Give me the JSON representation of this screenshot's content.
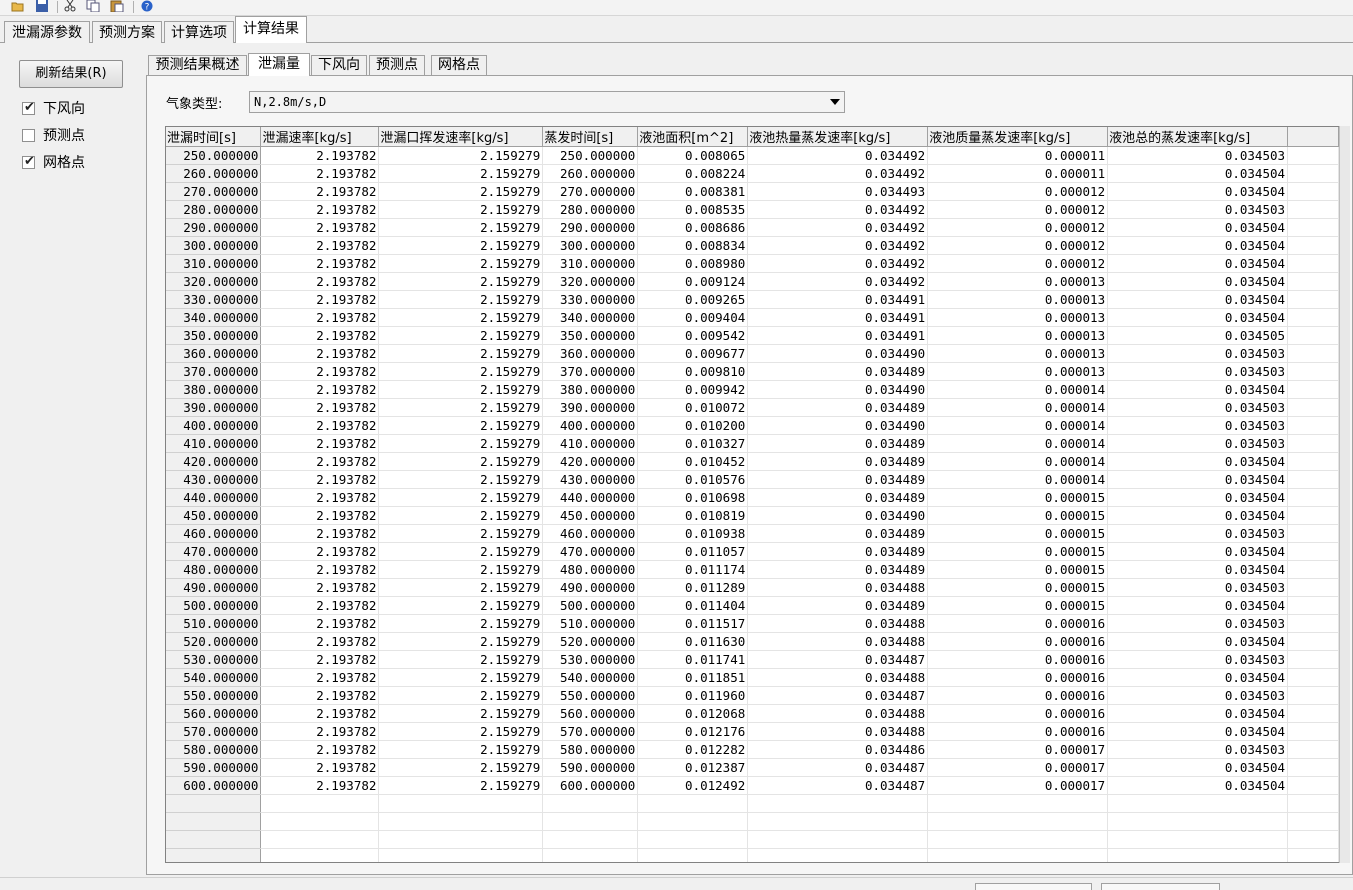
{
  "toolbar": {
    "icons": [
      "open-folder-icon",
      "save-icon",
      "cut-icon",
      "copy-icon",
      "paste-icon",
      "help-icon"
    ]
  },
  "main_tabs": [
    {
      "label": "泄漏源参数",
      "active": false
    },
    {
      "label": "预测方案",
      "active": false
    },
    {
      "label": "计算选项",
      "active": false
    },
    {
      "label": "计算结果",
      "active": true
    }
  ],
  "left_panel": {
    "refresh_label": "刷新结果(R)",
    "checkboxes": [
      {
        "label": "下风向",
        "checked": true
      },
      {
        "label": "预测点",
        "checked": false
      },
      {
        "label": "网格点",
        "checked": true
      }
    ]
  },
  "sub_tabs": [
    {
      "label": "预测结果概述",
      "active": false
    },
    {
      "label": "泄漏量",
      "active": true
    },
    {
      "label": "下风向",
      "active": false
    },
    {
      "label": "预测点",
      "active": false
    },
    {
      "label": "网格点",
      "active": false
    }
  ],
  "weather": {
    "label": "气象类型:",
    "value": "N,2.8m/s,D"
  },
  "table": {
    "columns": [
      "泄漏时间[s]",
      "泄漏速率[kg/s]",
      "泄漏口挥发速率[kg/s]",
      "蒸发时间[s]",
      "液池面积[m^2]",
      "液池热量蒸发速率[kg/s]",
      "液池质量蒸发速率[kg/s]",
      "液池总的蒸发速率[kg/s]"
    ],
    "rows": [
      [
        "250.000000",
        "2.193782",
        "2.159279",
        "250.000000",
        "0.008065",
        "0.034492",
        "0.000011",
        "0.034503"
      ],
      [
        "260.000000",
        "2.193782",
        "2.159279",
        "260.000000",
        "0.008224",
        "0.034492",
        "0.000011",
        "0.034504"
      ],
      [
        "270.000000",
        "2.193782",
        "2.159279",
        "270.000000",
        "0.008381",
        "0.034493",
        "0.000012",
        "0.034504"
      ],
      [
        "280.000000",
        "2.193782",
        "2.159279",
        "280.000000",
        "0.008535",
        "0.034492",
        "0.000012",
        "0.034503"
      ],
      [
        "290.000000",
        "2.193782",
        "2.159279",
        "290.000000",
        "0.008686",
        "0.034492",
        "0.000012",
        "0.034504"
      ],
      [
        "300.000000",
        "2.193782",
        "2.159279",
        "300.000000",
        "0.008834",
        "0.034492",
        "0.000012",
        "0.034504"
      ],
      [
        "310.000000",
        "2.193782",
        "2.159279",
        "310.000000",
        "0.008980",
        "0.034492",
        "0.000012",
        "0.034504"
      ],
      [
        "320.000000",
        "2.193782",
        "2.159279",
        "320.000000",
        "0.009124",
        "0.034492",
        "0.000013",
        "0.034504"
      ],
      [
        "330.000000",
        "2.193782",
        "2.159279",
        "330.000000",
        "0.009265",
        "0.034491",
        "0.000013",
        "0.034504"
      ],
      [
        "340.000000",
        "2.193782",
        "2.159279",
        "340.000000",
        "0.009404",
        "0.034491",
        "0.000013",
        "0.034504"
      ],
      [
        "350.000000",
        "2.193782",
        "2.159279",
        "350.000000",
        "0.009542",
        "0.034491",
        "0.000013",
        "0.034505"
      ],
      [
        "360.000000",
        "2.193782",
        "2.159279",
        "360.000000",
        "0.009677",
        "0.034490",
        "0.000013",
        "0.034503"
      ],
      [
        "370.000000",
        "2.193782",
        "2.159279",
        "370.000000",
        "0.009810",
        "0.034489",
        "0.000013",
        "0.034503"
      ],
      [
        "380.000000",
        "2.193782",
        "2.159279",
        "380.000000",
        "0.009942",
        "0.034490",
        "0.000014",
        "0.034504"
      ],
      [
        "390.000000",
        "2.193782",
        "2.159279",
        "390.000000",
        "0.010072",
        "0.034489",
        "0.000014",
        "0.034503"
      ],
      [
        "400.000000",
        "2.193782",
        "2.159279",
        "400.000000",
        "0.010200",
        "0.034490",
        "0.000014",
        "0.034503"
      ],
      [
        "410.000000",
        "2.193782",
        "2.159279",
        "410.000000",
        "0.010327",
        "0.034489",
        "0.000014",
        "0.034503"
      ],
      [
        "420.000000",
        "2.193782",
        "2.159279",
        "420.000000",
        "0.010452",
        "0.034489",
        "0.000014",
        "0.034504"
      ],
      [
        "430.000000",
        "2.193782",
        "2.159279",
        "430.000000",
        "0.010576",
        "0.034489",
        "0.000014",
        "0.034504"
      ],
      [
        "440.000000",
        "2.193782",
        "2.159279",
        "440.000000",
        "0.010698",
        "0.034489",
        "0.000015",
        "0.034504"
      ],
      [
        "450.000000",
        "2.193782",
        "2.159279",
        "450.000000",
        "0.010819",
        "0.034490",
        "0.000015",
        "0.034504"
      ],
      [
        "460.000000",
        "2.193782",
        "2.159279",
        "460.000000",
        "0.010938",
        "0.034489",
        "0.000015",
        "0.034503"
      ],
      [
        "470.000000",
        "2.193782",
        "2.159279",
        "470.000000",
        "0.011057",
        "0.034489",
        "0.000015",
        "0.034504"
      ],
      [
        "480.000000",
        "2.193782",
        "2.159279",
        "480.000000",
        "0.011174",
        "0.034489",
        "0.000015",
        "0.034504"
      ],
      [
        "490.000000",
        "2.193782",
        "2.159279",
        "490.000000",
        "0.011289",
        "0.034488",
        "0.000015",
        "0.034503"
      ],
      [
        "500.000000",
        "2.193782",
        "2.159279",
        "500.000000",
        "0.011404",
        "0.034489",
        "0.000015",
        "0.034504"
      ],
      [
        "510.000000",
        "2.193782",
        "2.159279",
        "510.000000",
        "0.011517",
        "0.034488",
        "0.000016",
        "0.034503"
      ],
      [
        "520.000000",
        "2.193782",
        "2.159279",
        "520.000000",
        "0.011630",
        "0.034488",
        "0.000016",
        "0.034504"
      ],
      [
        "530.000000",
        "2.193782",
        "2.159279",
        "530.000000",
        "0.011741",
        "0.034487",
        "0.000016",
        "0.034503"
      ],
      [
        "540.000000",
        "2.193782",
        "2.159279",
        "540.000000",
        "0.011851",
        "0.034488",
        "0.000016",
        "0.034504"
      ],
      [
        "550.000000",
        "2.193782",
        "2.159279",
        "550.000000",
        "0.011960",
        "0.034487",
        "0.000016",
        "0.034503"
      ],
      [
        "560.000000",
        "2.193782",
        "2.159279",
        "560.000000",
        "0.012068",
        "0.034488",
        "0.000016",
        "0.034504"
      ],
      [
        "570.000000",
        "2.193782",
        "2.159279",
        "570.000000",
        "0.012176",
        "0.034488",
        "0.000016",
        "0.034504"
      ],
      [
        "580.000000",
        "2.193782",
        "2.159279",
        "580.000000",
        "0.012282",
        "0.034486",
        "0.000017",
        "0.034503"
      ],
      [
        "590.000000",
        "2.193782",
        "2.159279",
        "590.000000",
        "0.012387",
        "0.034487",
        "0.000017",
        "0.034504"
      ],
      [
        "600.000000",
        "2.193782",
        "2.159279",
        "600.000000",
        "0.012492",
        "0.034487",
        "0.000017",
        "0.034504"
      ]
    ]
  }
}
